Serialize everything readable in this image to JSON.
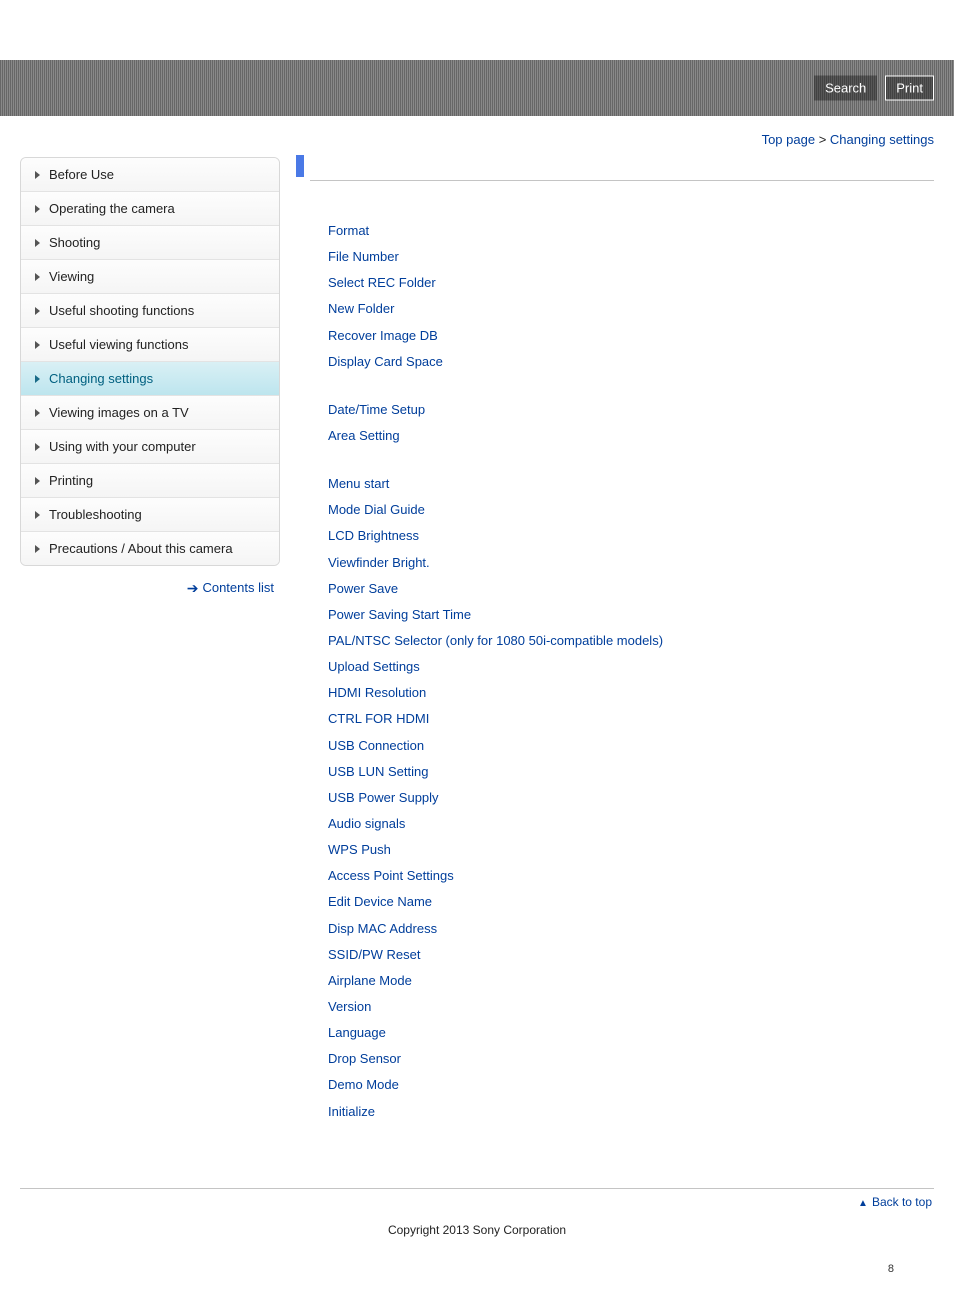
{
  "header": {
    "search_label": "Search",
    "print_label": "Print"
  },
  "breadcrumb": {
    "top_page": "Top page",
    "separator": ">",
    "current": "Changing settings"
  },
  "sidebar": {
    "items": [
      {
        "label": "Before Use",
        "active": false
      },
      {
        "label": "Operating the camera",
        "active": false
      },
      {
        "label": "Shooting",
        "active": false
      },
      {
        "label": "Viewing",
        "active": false
      },
      {
        "label": "Useful shooting functions",
        "active": false
      },
      {
        "label": "Useful viewing functions",
        "active": false
      },
      {
        "label": "Changing settings",
        "active": true
      },
      {
        "label": "Viewing images on a TV",
        "active": false
      },
      {
        "label": "Using with your computer",
        "active": false
      },
      {
        "label": "Printing",
        "active": false
      },
      {
        "label": "Troubleshooting",
        "active": false
      },
      {
        "label": "Precautions / About this camera",
        "active": false
      }
    ],
    "contents_list": "Contents list"
  },
  "main": {
    "groups": [
      [
        "Format",
        "File Number",
        "Select REC Folder",
        "New Folder",
        "Recover Image DB",
        "Display Card Space"
      ],
      [
        "Date/Time Setup",
        "Area Setting"
      ],
      [
        "Menu start",
        "Mode Dial Guide",
        "LCD Brightness",
        "Viewfinder Bright.",
        "Power Save",
        "Power Saving Start Time",
        "PAL/NTSC Selector (only for 1080 50i-compatible models)",
        "Upload Settings",
        "HDMI Resolution",
        "CTRL FOR HDMI",
        "USB Connection",
        "USB LUN Setting",
        "USB Power Supply",
        "Audio signals",
        "WPS Push",
        "Access Point Settings",
        "Edit Device Name",
        "Disp MAC Address",
        "SSID/PW Reset",
        "Airplane Mode",
        "Version",
        "Language",
        "Drop Sensor",
        "Demo Mode",
        "Initialize"
      ]
    ]
  },
  "footer": {
    "back_to_top": "Back to top",
    "copyright": "Copyright 2013 Sony Corporation",
    "page_number": "8"
  }
}
